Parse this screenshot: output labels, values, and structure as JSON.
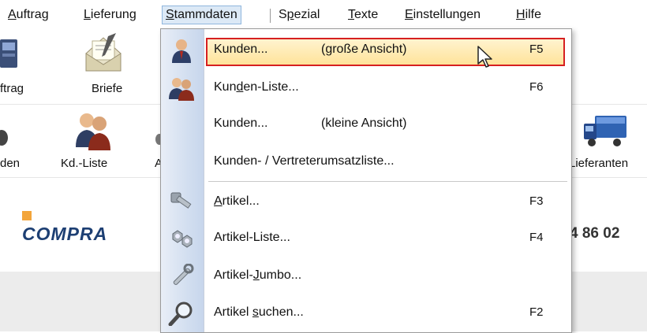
{
  "menubar": {
    "items": [
      {
        "pre": "",
        "ul": "A",
        "post": "uftrag"
      },
      {
        "pre": "",
        "ul": "L",
        "post": "ieferung"
      },
      {
        "pre": "",
        "ul": "S",
        "post": "tammdaten"
      },
      {
        "pre": "S",
        "ul": "p",
        "post": "ezial"
      },
      {
        "pre": "",
        "ul": "T",
        "post": "exte"
      },
      {
        "pre": "",
        "ul": "E",
        "post": "instellungen"
      },
      {
        "pre": "",
        "ul": "H",
        "post": "ilfe"
      }
    ]
  },
  "toolbar1": {
    "auftrag_label": "ftrag",
    "briefe_label": "Briefe"
  },
  "toolbar2": {
    "kunden_label": "den",
    "kdliste_label": "Kd.-Liste",
    "a_label": "A",
    "lieferanten_label": "Lieferanten"
  },
  "logo": {
    "text": "COMPRA"
  },
  "phone_fragment": "4 86 02",
  "dropdown": {
    "items": [
      {
        "label": "Kunden...",
        "sub": "(große Ansicht)",
        "key": "F5"
      },
      {
        "pre": "Kun",
        "ul": "d",
        "post": "en-Liste...",
        "key": "F6"
      },
      {
        "label": "Kunden...",
        "sub": "(kleine Ansicht)",
        "key": ""
      },
      {
        "label": "Kunden- / Vertreterumsatzliste...",
        "key": ""
      },
      {
        "pre": "",
        "ul": "A",
        "post": "rtikel...",
        "key": "F3"
      },
      {
        "label": "Artikel-Liste...",
        "key": "F4"
      },
      {
        "pre": "Artikel-",
        "ul": "J",
        "post": "umbo...",
        "key": ""
      },
      {
        "pre": "Artikel ",
        "ul": "s",
        "post": "uchen...",
        "key": "F2"
      }
    ]
  },
  "colors": {
    "highlight_border": "#d62020",
    "highlight_fill": "#ffe39a",
    "menu_active": "#dce9f6"
  }
}
